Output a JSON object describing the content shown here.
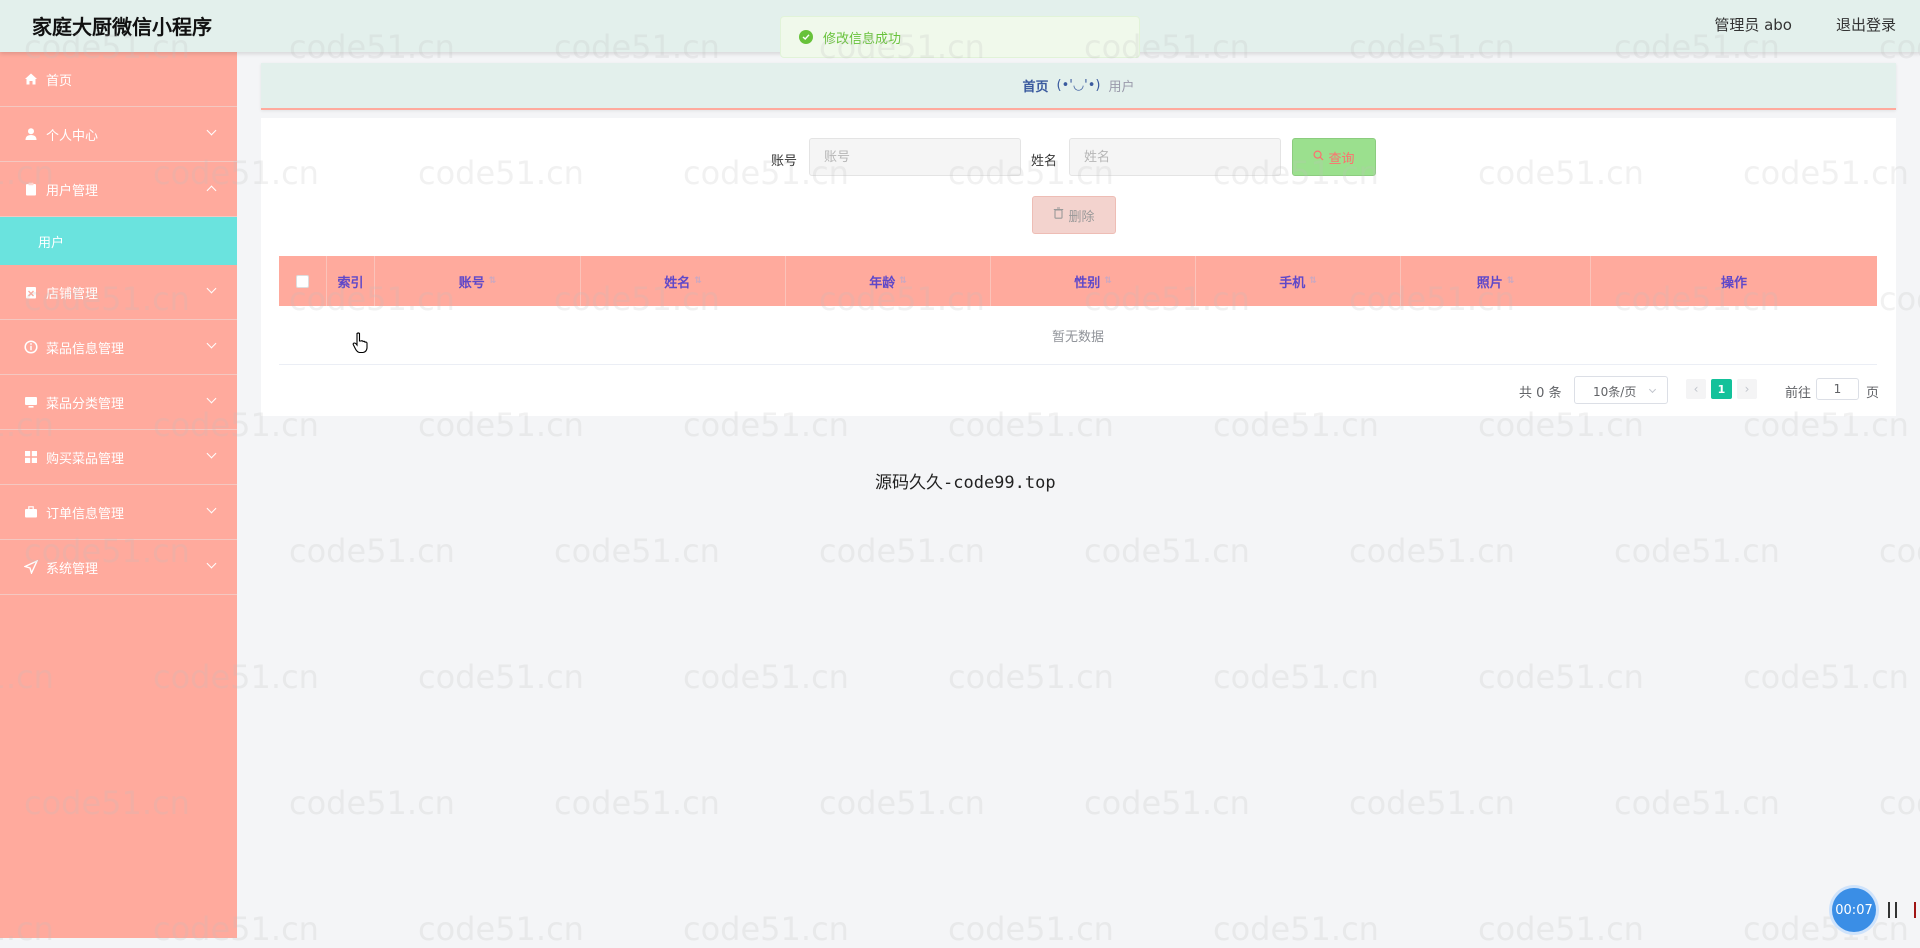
{
  "header": {
    "title": "家庭大厨微信小程序",
    "admin_label": "管理员 abo",
    "logout": "退出登录"
  },
  "toast": {
    "message": "修改信息成功"
  },
  "sidebar": {
    "items": [
      {
        "label": "首页",
        "icon": "home-icon"
      },
      {
        "label": "个人中心",
        "icon": "user-icon"
      },
      {
        "label": "用户管理",
        "icon": "clipboard-icon"
      },
      {
        "label": "店铺管理",
        "icon": "shop-icon"
      },
      {
        "label": "菜品信息管理",
        "icon": "info-icon"
      },
      {
        "label": "菜品分类管理",
        "icon": "monitor-icon"
      },
      {
        "label": "购买菜品管理",
        "icon": "grid-icon"
      },
      {
        "label": "订单信息管理",
        "icon": "briefcase-icon"
      },
      {
        "label": "系统管理",
        "icon": "send-icon"
      }
    ],
    "submenu": {
      "label": "用户"
    }
  },
  "breadcrumb": {
    "home": "首页",
    "separator": "(•'◡'•)",
    "current": "用户"
  },
  "search": {
    "account_label": "账号",
    "account_placeholder": "账号",
    "name_label": "姓名",
    "name_placeholder": "姓名",
    "query_button": "查询"
  },
  "actions": {
    "delete_button": "删除"
  },
  "table": {
    "columns": [
      "索引",
      "账号",
      "姓名",
      "年龄",
      "性别",
      "手机",
      "照片",
      "操作"
    ],
    "empty_text": "暂无数据"
  },
  "pagination": {
    "total_text": "共 0 条",
    "page_size": "10条/页",
    "current_page": "1",
    "goto_label": "前往",
    "goto_value": "1",
    "page_suffix": "页"
  },
  "footer": {
    "text": "源码久久-code99.top"
  },
  "watermark": {
    "text": "code51.cn"
  },
  "recorder": {
    "time": "00:07"
  },
  "colors": {
    "header_bg": "#e3f0ec",
    "sidebar_bg": "#ffaa9d",
    "submenu_active": "#6ae3de",
    "query_button": "#9be08e",
    "pager_active": "#13c19a"
  }
}
